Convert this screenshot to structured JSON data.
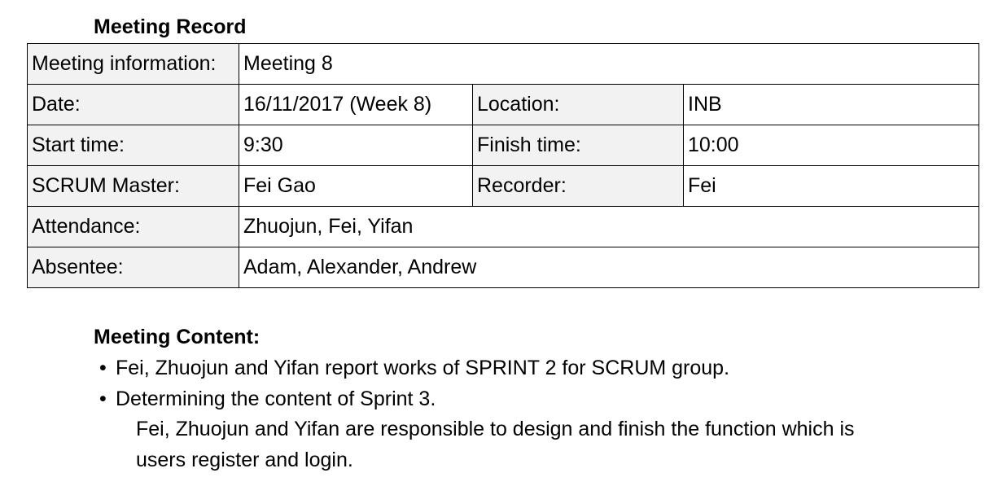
{
  "title": "Meeting Record",
  "meeting_info": {
    "meeting_label": "Meeting information:",
    "meeting_value": "Meeting 8",
    "date_label": "Date:",
    "date_value": "16/11/2017 (Week 8)",
    "location_label": "Location:",
    "location_value": "INB",
    "start_label": "Start time:",
    "start_value": "9:30",
    "finish_label": "Finish time:",
    "finish_value": "10:00",
    "scrum_master_label": "SCRUM Master:",
    "scrum_master_value": "Fei Gao",
    "recorder_label": "Recorder:",
    "recorder_value": "Fei",
    "attendance_label": "Attendance:",
    "attendance_value": "Zhuojun, Fei, Yifan",
    "absentee_label": "Absentee:",
    "absentee_value": "Adam, Alexander, Andrew"
  },
  "content": {
    "heading": "Meeting Content:",
    "bullet_symbol": "•",
    "items": [
      {
        "text": "Fei, Zhuojun and Yifan report works of SPRINT 2 for SCRUM group."
      },
      {
        "text": "Determining the content of Sprint 3."
      }
    ],
    "detail_lines": [
      "Fei, Zhuojun and Yifan are responsible to design and finish the function which is",
      "users register and login."
    ]
  },
  "colors": {
    "label_cell_background": "#f2f2f2",
    "border": "#000000",
    "text": "#000000"
  }
}
